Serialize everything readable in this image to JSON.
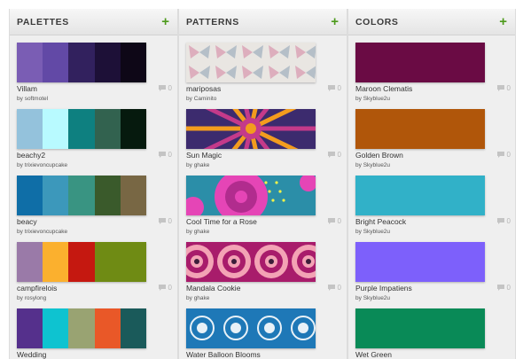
{
  "columns": {
    "palettes": {
      "title": "PALETTES",
      "items": [
        {
          "name": "Villam",
          "author": "softmotel",
          "comments": "0",
          "colors": [
            "#7a5db4",
            "#6249a6",
            "#32215e",
            "#1d1037",
            "#0e0717"
          ]
        },
        {
          "name": "beachy2",
          "author": "trixievoncupcake",
          "comments": "0",
          "colors": [
            "#94c2dc",
            "#b8faff",
            "#0e8080",
            "#32624f",
            "#061a0e"
          ]
        },
        {
          "name": "beacy",
          "author": "trixievoncupcake",
          "comments": "0",
          "colors": [
            "#0f6ea7",
            "#3c98bb",
            "#399482",
            "#3a5a2b",
            "#786744"
          ]
        },
        {
          "name": "campfirelois",
          "author": "rosylong",
          "comments": "0",
          "colors": [
            "#9a7aa8",
            "#fbb02e",
            "#c51810",
            "#6f8b14",
            "#6f8b14"
          ]
        },
        {
          "name": "Wedding",
          "author": "",
          "comments": "",
          "colors": [
            "#55308c",
            "#0ec3d0",
            "#99a372",
            "#e95828",
            "#1a5a5a"
          ]
        }
      ]
    },
    "patterns": {
      "title": "PATTERNS",
      "items": [
        {
          "name": "mariposas",
          "author": "Caminito",
          "comments": "0",
          "colors": [
            "#e9e6e2",
            "#d9a0b4",
            "#a8b5c2"
          ]
        },
        {
          "name": "Sun Magic",
          "author": "ghake",
          "comments": "0",
          "colors": [
            "#c43a8a",
            "#f39c1e",
            "#3c2b6e"
          ]
        },
        {
          "name": "Cool Time for a Rose",
          "author": "ghake",
          "comments": "0",
          "colors": [
            "#e545b6",
            "#2b8ea8",
            "#f0f24a"
          ]
        },
        {
          "name": "Mandala Cookie",
          "author": "ghake",
          "comments": "0",
          "colors": [
            "#a81c6b",
            "#f3a3b5",
            "#3c1e3a"
          ]
        },
        {
          "name": "Water Balloon Blooms",
          "author": "",
          "comments": "",
          "colors": [
            "#1e78b7",
            "#e8f1f7",
            "#0b3f6a"
          ]
        }
      ]
    },
    "colors": {
      "title": "COLORS",
      "items": [
        {
          "name": "Maroon Clematis",
          "author": "Skyblue2u",
          "comments": "0",
          "colors": [
            "#6a0b44"
          ]
        },
        {
          "name": "Golden Brown",
          "author": "Skyblue2u",
          "comments": "0",
          "colors": [
            "#b0560a"
          ]
        },
        {
          "name": "Bright Peacock",
          "author": "Skyblue2u",
          "comments": "0",
          "colors": [
            "#31b1c8"
          ]
        },
        {
          "name": "Purple Impatiens",
          "author": "Skyblue2u",
          "comments": "0",
          "colors": [
            "#7d60fb"
          ]
        },
        {
          "name": "Wet Green",
          "author": "",
          "comments": "",
          "colors": [
            "#098a57"
          ]
        }
      ]
    }
  },
  "by_label": "by",
  "add_icon": "plus-icon",
  "comment_icon": "speech-bubble-icon"
}
